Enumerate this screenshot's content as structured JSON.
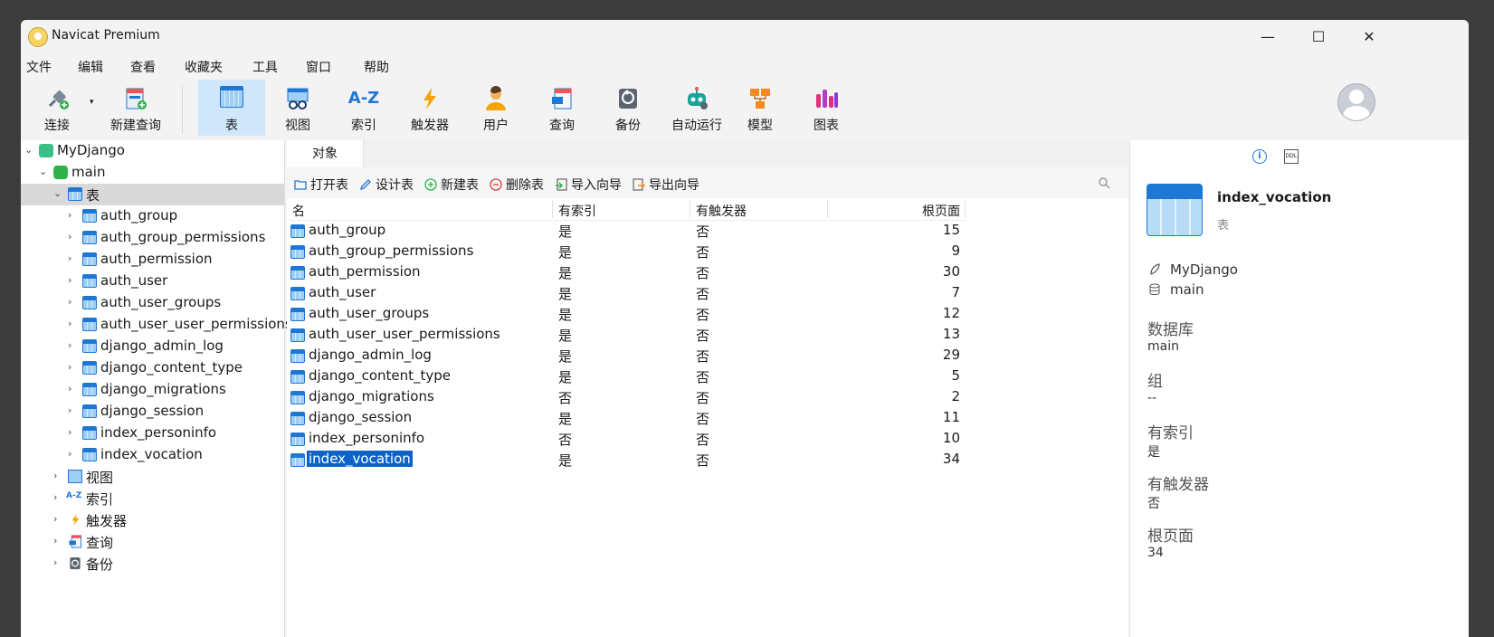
{
  "window": {
    "title": "Navicat Premium",
    "min": "—",
    "max": "☐",
    "close": "✕"
  },
  "menu": [
    "文件",
    "编辑",
    "查看",
    "收藏夹",
    "工具",
    "窗口",
    "帮助"
  ],
  "toolbar": {
    "connect": "连接",
    "new_query": "新建查询",
    "buttons": [
      "表",
      "视图",
      "索引",
      "触发器",
      "用户",
      "查询",
      "备份",
      "自动运行",
      "模型",
      "图表"
    ],
    "active": "表",
    "index_glyph": "A-Z"
  },
  "tree": {
    "connection": "MyDjango",
    "database": "main",
    "tables_label": "表",
    "tables": [
      "auth_group",
      "auth_group_permissions",
      "auth_permission",
      "auth_user",
      "auth_user_groups",
      "auth_user_user_permissions",
      "django_admin_log",
      "django_content_type",
      "django_migrations",
      "django_session",
      "index_personinfo",
      "index_vocation"
    ],
    "others": [
      "视图",
      "索引",
      "触发器",
      "查询",
      "备份"
    ]
  },
  "main": {
    "tab": "对象",
    "actions": [
      "打开表",
      "设计表",
      "新建表",
      "删除表",
      "导入向导",
      "导出向导"
    ],
    "columns": [
      "名",
      "有索引",
      "有触发器",
      "根页面"
    ],
    "rows": [
      {
        "name": "auth_group",
        "index": "是",
        "trigger": "否",
        "root": "15"
      },
      {
        "name": "auth_group_permissions",
        "index": "是",
        "trigger": "否",
        "root": "9"
      },
      {
        "name": "auth_permission",
        "index": "是",
        "trigger": "否",
        "root": "30"
      },
      {
        "name": "auth_user",
        "index": "是",
        "trigger": "否",
        "root": "7"
      },
      {
        "name": "auth_user_groups",
        "index": "是",
        "trigger": "否",
        "root": "12"
      },
      {
        "name": "auth_user_user_permissions",
        "index": "是",
        "trigger": "否",
        "root": "13"
      },
      {
        "name": "django_admin_log",
        "index": "是",
        "trigger": "否",
        "root": "29"
      },
      {
        "name": "django_content_type",
        "index": "是",
        "trigger": "否",
        "root": "5"
      },
      {
        "name": "django_migrations",
        "index": "否",
        "trigger": "否",
        "root": "2"
      },
      {
        "name": "django_session",
        "index": "是",
        "trigger": "否",
        "root": "11"
      },
      {
        "name": "index_personinfo",
        "index": "否",
        "trigger": "否",
        "root": "10"
      },
      {
        "name": "index_vocation",
        "index": "是",
        "trigger": "否",
        "root": "34"
      }
    ],
    "selected_row": "index_vocation"
  },
  "info": {
    "info_glyph": "i",
    "ddl_glyph": "DDL",
    "title": "index_vocation",
    "subtitle": "表",
    "connection": "MyDjango",
    "schema": "main",
    "fields": [
      {
        "key": "数据库",
        "value": "main"
      },
      {
        "key": "组",
        "value": "--"
      },
      {
        "key": "有索引",
        "value": "是"
      },
      {
        "key": "有触发器",
        "value": "否"
      },
      {
        "key": "根页面",
        "value": "34"
      }
    ]
  },
  "colors": {
    "accent": "#0b63c8",
    "active_tool": "#cfe6fb",
    "tree_selected": "#d9d9d9"
  }
}
